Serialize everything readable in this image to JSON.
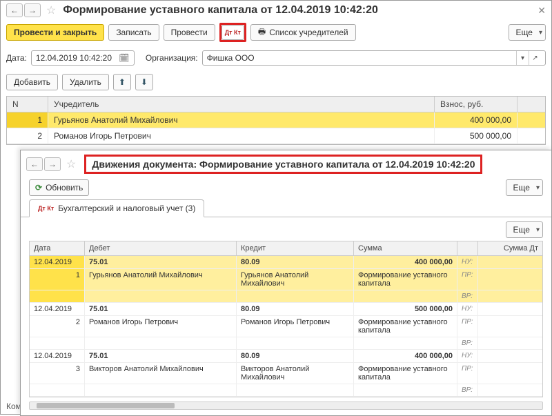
{
  "topWindow": {
    "title": "Формирование уставного капитала от 12.04.2019 10:42:20",
    "btn_post_close": "Провести и закрыть",
    "btn_save": "Записать",
    "btn_post": "Провести",
    "btn_dtkt": "Дт Кт",
    "btn_founders": "Список учредителей",
    "btn_more": "Еще",
    "label_date": "Дата:",
    "date_value": "12.04.2019 10:42:20",
    "label_org": "Организация:",
    "org_value": "Фишка ООО",
    "btn_add": "Добавить",
    "btn_delete": "Удалить",
    "col_n": "N",
    "col_founder": "Учредитель",
    "col_amount": "Взнос, руб.",
    "rows": [
      {
        "n": "1",
        "name": "Гурьянов Анатолий Михайлович",
        "amount": "400 000,00"
      },
      {
        "n": "2",
        "name": "Романов Игорь Петрович",
        "amount": "500 000,00"
      }
    ],
    "comment_label": "Комм"
  },
  "subWindow": {
    "title": "Движения документа: Формирование уставного капитала от 12.04.2019 10:42:20",
    "btn_refresh": "Обновить",
    "btn_more": "Еще",
    "tab_label": "Бухгалтерский и налоговый учет (3)",
    "tab_dk": "Дт Кт",
    "cols": {
      "date": "Дата",
      "debit": "Дебет",
      "credit": "Кредит",
      "sum": "Сумма",
      "sumdt": "Сумма Дт"
    },
    "flags": {
      "nu": "НУ:",
      "pr": "ПР:",
      "vr": "ВР:"
    },
    "entries": [
      {
        "date": "12.04.2019",
        "n": "1",
        "debit_acc": "75.01",
        "credit_acc": "80.09",
        "sum": "400 000,00",
        "debit_sub": "Гурьянов Анатолий Михайлович",
        "credit_sub": "Гурьянов Анатолий Михайлович",
        "desc": "Формирование уставного капитала",
        "sel": true
      },
      {
        "date": "12.04.2019",
        "n": "2",
        "debit_acc": "75.01",
        "credit_acc": "80.09",
        "sum": "500 000,00",
        "debit_sub": "Романов Игорь Петрович",
        "credit_sub": "Романов Игорь Петрович",
        "desc": "Формирование уставного капитала",
        "sel": false
      },
      {
        "date": "12.04.2019",
        "n": "3",
        "debit_acc": "75.01",
        "credit_acc": "80.09",
        "sum": "400 000,00",
        "debit_sub": "Викторов Анатолий Михайлович",
        "credit_sub": "Викторов Анатолий Михайлович",
        "desc": "Формирование уставного капитала",
        "sel": false
      }
    ]
  }
}
